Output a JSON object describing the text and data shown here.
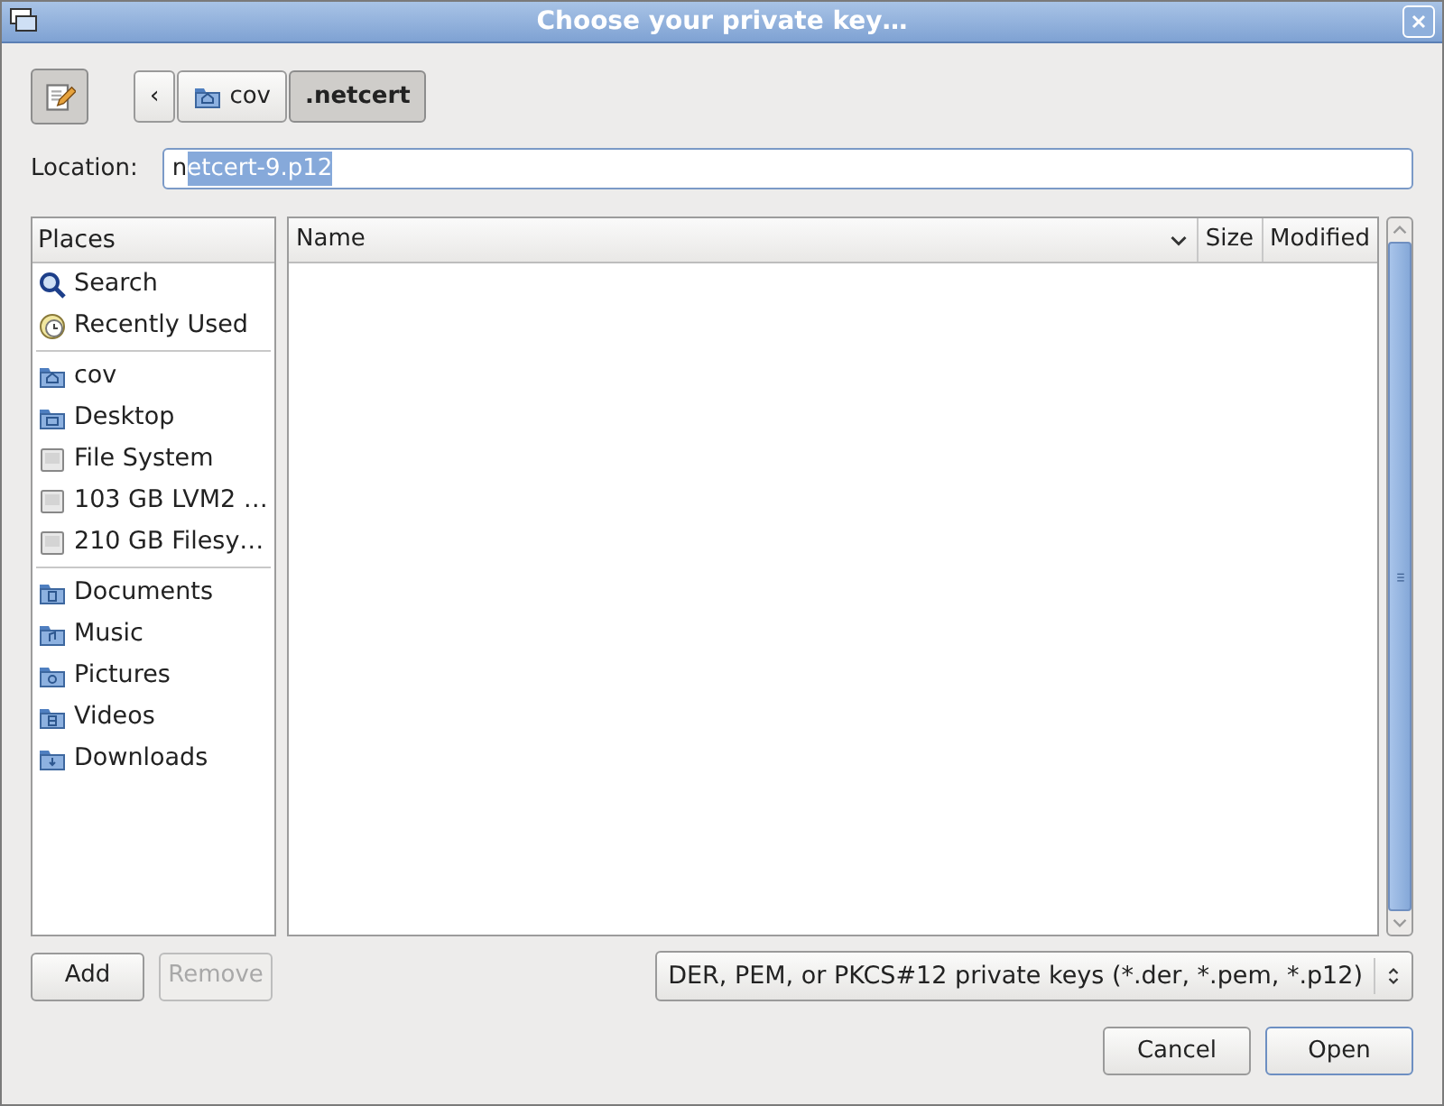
{
  "window": {
    "title": "Choose your private key…"
  },
  "path_bar": {
    "edit_toggle": {
      "pressed": true
    },
    "back": "‹",
    "crumbs": [
      {
        "label": "cov",
        "kind": "home",
        "selected": false
      },
      {
        "label": ".netcert",
        "selected": true
      }
    ]
  },
  "location": {
    "label": "Location:",
    "unselected_text": "n",
    "selected_text": "etcert-9.p12"
  },
  "places": {
    "heading": "Places",
    "groups": [
      [
        {
          "label": "Search",
          "kind": "search"
        },
        {
          "label": "Recently Used",
          "kind": "recent"
        }
      ],
      [
        {
          "label": "cov",
          "kind": "home"
        },
        {
          "label": "Desktop",
          "kind": "desktop"
        },
        {
          "label": "File System",
          "kind": "drive"
        },
        {
          "label": "103 GB LVM2 …",
          "kind": "drive"
        },
        {
          "label": "210 GB Filesy…",
          "kind": "drive"
        }
      ],
      [
        {
          "label": "Documents",
          "kind": "documents"
        },
        {
          "label": "Music",
          "kind": "music"
        },
        {
          "label": "Pictures",
          "kind": "pictures"
        },
        {
          "label": "Videos",
          "kind": "videos"
        },
        {
          "label": "Downloads",
          "kind": "downloads"
        }
      ]
    ]
  },
  "files": {
    "columns": [
      {
        "label": "Name",
        "sorted": true
      },
      {
        "label": "Size",
        "sorted": false
      },
      {
        "label": "Modified",
        "sorted": false
      }
    ]
  },
  "place_buttons": [
    {
      "label": "Add",
      "disabled": false
    },
    {
      "label": "Remove",
      "disabled": true
    }
  ],
  "filter": {
    "value": "DER, PEM, or PKCS#12 private keys (*.der, *.pem, *.p12)"
  },
  "actions": [
    {
      "label": "Cancel",
      "default": false
    },
    {
      "label": "Open",
      "default": true
    }
  ]
}
